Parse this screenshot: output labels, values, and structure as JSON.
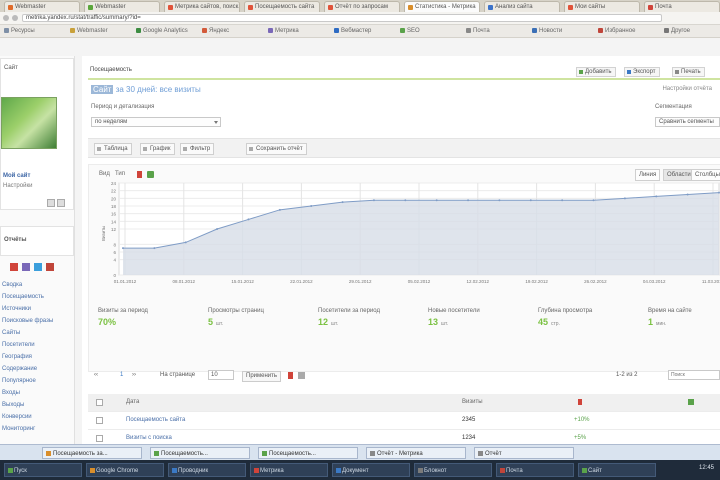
{
  "browser": {
    "tabs": [
      {
        "label": "Webmaster",
        "color": "#e06b2b",
        "active": false
      },
      {
        "label": "Webmaster",
        "color": "#5ba63b",
        "active": false
      },
      {
        "label": "Метрика сайтов, поиск...",
        "color": "#e0533a",
        "active": false
      },
      {
        "label": "Посещаемость сайта",
        "color": "#e0533a",
        "active": false
      },
      {
        "label": "Отчёт по запросам",
        "color": "#e0533a",
        "active": false
      },
      {
        "label": "Статистика - Метрика",
        "color": "#d98e2b",
        "active": true
      },
      {
        "label": "Анализ сайта",
        "color": "#3d73c9",
        "active": false
      },
      {
        "label": "Мои сайты",
        "color": "#e0533a",
        "active": false
      },
      {
        "label": "Почта",
        "color": "#d0443a",
        "active": false
      }
    ],
    "url": "metrika.yandex.ru/stat/traffic/summary/?id=",
    "bookmarks": [
      {
        "label": "Ресурсы",
        "color": "#7e8fa6"
      },
      {
        "label": "Webmaster",
        "color": "#c9a13a"
      },
      {
        "label": "Google Analytics",
        "color": "#3c8c41"
      },
      {
        "label": "Яндекс",
        "color": "#d35a3a"
      },
      {
        "label": "Метрика",
        "color": "#7a68b8"
      },
      {
        "label": "Вебмастер",
        "color": "#2d6bc3"
      },
      {
        "label": "SEO",
        "color": "#5aa24a"
      },
      {
        "label": "Почта",
        "color": "#888888"
      },
      {
        "label": "Новости",
        "color": "#3b6fb6"
      },
      {
        "label": "Избранное",
        "color": "#c0453a"
      },
      {
        "label": "Другое",
        "color": "#777777"
      }
    ]
  },
  "sidebar": {
    "top_label": "Сайт",
    "site_name": "Мой сайт",
    "site_sub": "Настройки",
    "section": "Отчёты",
    "links": [
      "Сводка",
      "Посещаемость",
      "Источники",
      "Поисковые фразы",
      "Сайты",
      "Посетители",
      "География",
      "Содержание",
      "Популярное",
      "Входы",
      "Выходы",
      "Конверсии",
      "Мониторинг"
    ]
  },
  "header": {
    "title": "Посещаемость",
    "actions": [
      {
        "label": "Добавить",
        "color": "#5aa24a"
      },
      {
        "label": "Экспорт",
        "color": "#3b79c4"
      },
      {
        "label": "Печать",
        "color": "#888888"
      }
    ]
  },
  "page": {
    "heading_selected": "Сайт",
    "heading_rest": "за 30 дней: все визиты",
    "right_link": "Настройки отчёта",
    "filter1_label": "Период и детализация",
    "filter1_value": "по неделям",
    "filter2_label": "Сегментация",
    "filter2_value": "Сравнить сегменты"
  },
  "toolbar": [
    {
      "label": "Таблица"
    },
    {
      "label": "График"
    },
    {
      "label": "Фильтр"
    },
    {
      "label": "Сохранить отчёт"
    }
  ],
  "chart_controls": {
    "left": [
      "Вид",
      "Тип"
    ],
    "segments": [
      "Линия",
      "Области",
      "Столбцы"
    ],
    "active_segment": 1
  },
  "chart_data": {
    "type": "area",
    "x": [
      "01.01.2012",
      "08.01.2012",
      "15.01.2012",
      "22.01.2012",
      "29.01.2012",
      "05.02.2012",
      "12.02.2012",
      "19.02.2012",
      "26.02.2012",
      "04.03.2012",
      "11.03.2012"
    ],
    "series": [
      {
        "values": [
          7,
          7,
          8.5,
          12,
          14.5,
          17,
          18,
          19,
          19.5,
          19.5,
          19.5,
          19.5,
          19.5,
          19.5,
          19.5,
          19.5,
          20,
          20.5,
          21,
          21.5
        ]
      }
    ],
    "yticks": [
      0,
      4,
      6,
      8,
      12,
      14,
      16,
      18,
      20,
      22,
      24
    ],
    "ylim": [
      0,
      24
    ],
    "ylabel": "Визиты",
    "grid": true,
    "fill": "#d7dde7",
    "line": "#7f9cc6"
  },
  "stats": [
    {
      "label": "Визиты за период",
      "value": "70%",
      "unit": ""
    },
    {
      "label": "Просмотры страниц",
      "value": "5",
      "unit": "шт."
    },
    {
      "label": "Посетители за период",
      "value": "12",
      "unit": "шт."
    },
    {
      "label": "Новые посетители",
      "value": "13",
      "unit": "шт."
    },
    {
      "label": "Глубина просмотра",
      "value": "45",
      "unit": "стр."
    },
    {
      "label": "Время на сайте",
      "value": "1",
      "unit": "мин."
    }
  ],
  "pager": {
    "prev": "‹‹",
    "page": "1",
    "next": "››",
    "rows_label": "На странице",
    "rows_value": "10",
    "action": "Применить",
    "right_label": "1-2 из 2",
    "search_placeholder": "Поиск"
  },
  "table": {
    "headers": [
      "Дата",
      "Визиты",
      "",
      ""
    ],
    "rows": [
      {
        "name": "Посещаемость сайта",
        "value": "2345",
        "delta": "+10%"
      },
      {
        "name": "Визиты с поиска",
        "value": "1234",
        "delta": "+5%"
      }
    ]
  },
  "windows_taskbar": [
    {
      "label": "Посещаемость за...",
      "color": "#d98e2b"
    },
    {
      "label": "Посещаемость...",
      "color": "#5aa24a"
    },
    {
      "label": "Посещаемость...",
      "color": "#5aa24a"
    },
    {
      "label": "Отчёт - Метрика",
      "color": "#888888"
    },
    {
      "label": "Отчёт",
      "color": "#888888"
    }
  ],
  "system_taskbar": [
    {
      "label": "Пуск",
      "color": "#5aa24a"
    },
    {
      "label": "Google Chrome",
      "color": "#d98e2b"
    },
    {
      "label": "Проводник",
      "color": "#3b79c4"
    },
    {
      "label": "Метрика",
      "color": "#d0443a"
    },
    {
      "label": "Документ",
      "color": "#3b79c4"
    },
    {
      "label": "Блокнот",
      "color": "#7a7a7a"
    },
    {
      "label": "Почта",
      "color": "#c0453a"
    },
    {
      "label": "Сайт",
      "color": "#5aa24a"
    }
  ],
  "clock": "12:45"
}
